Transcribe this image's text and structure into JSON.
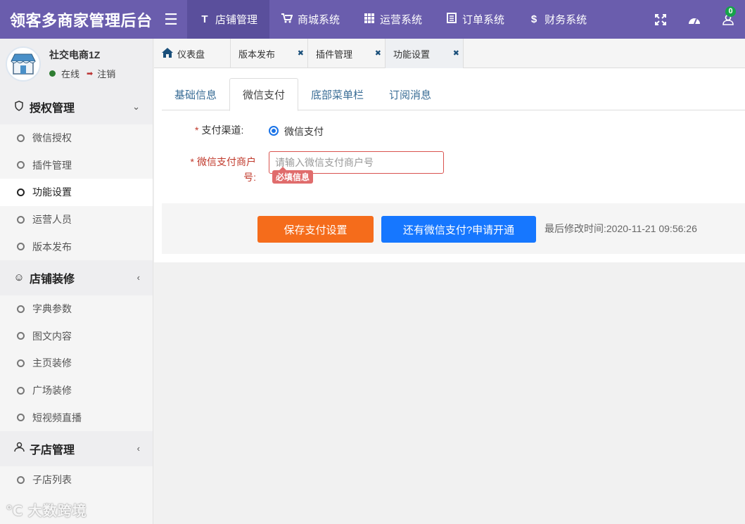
{
  "app": {
    "title": "领客多商家管理后台"
  },
  "topnav": {
    "items": [
      {
        "label": "店铺管理",
        "icon": "text-icon",
        "active": true
      },
      {
        "label": "商城系统",
        "icon": "cart-icon"
      },
      {
        "label": "运营系统",
        "icon": "grid-icon"
      },
      {
        "label": "订单系统",
        "icon": "list-icon"
      },
      {
        "label": "财务系统",
        "icon": "dollar-icon"
      }
    ],
    "notification_count": "0"
  },
  "user": {
    "name": "社交电商1Z",
    "status": "在线",
    "logout": "注销"
  },
  "sidebar": {
    "groups": [
      {
        "label": "授权管理",
        "icon": "shield-icon",
        "items": [
          "微信授权",
          "插件管理",
          "功能设置",
          "运营人员",
          "版本发布"
        ]
      },
      {
        "label": "店铺装修",
        "icon": "smile-icon",
        "items": [
          "字典参数",
          "图文内容",
          "主页装修",
          "广场装修",
          "短视频直播"
        ]
      },
      {
        "label": "子店管理",
        "icon": "user-icon",
        "items": [
          "子店列表"
        ]
      }
    ],
    "active_item": "功能设置",
    "watermark": "大数跨境"
  },
  "tabs": [
    {
      "label": "仪表盘",
      "icon": "home-icon"
    },
    {
      "label": "版本发布",
      "closable": true
    },
    {
      "label": "插件管理",
      "closable": true
    },
    {
      "label": "功能设置",
      "closable": true,
      "active": true
    }
  ],
  "subtabs": [
    "基础信息",
    "微信支付",
    "底部菜单栏",
    "订阅消息"
  ],
  "form": {
    "channel_label": "支付渠道:",
    "channel_option": "微信支付",
    "merchant_label": "微信支付商户号:",
    "merchant_placeholder": "请输入微信支付商户号",
    "merchant_value": "",
    "required_tip": "必填信息",
    "required_mark": "*"
  },
  "actions": {
    "save": "保存支付设置",
    "apply": "还有微信支付?申请开通",
    "last_modified_label": "最后修改时间:",
    "last_modified_value": "2020-11-21 09:56:26"
  },
  "colors": {
    "topbar": "#6a5dad",
    "save": "#f56c1b",
    "apply": "#1677ff",
    "error": "#d9534f"
  }
}
